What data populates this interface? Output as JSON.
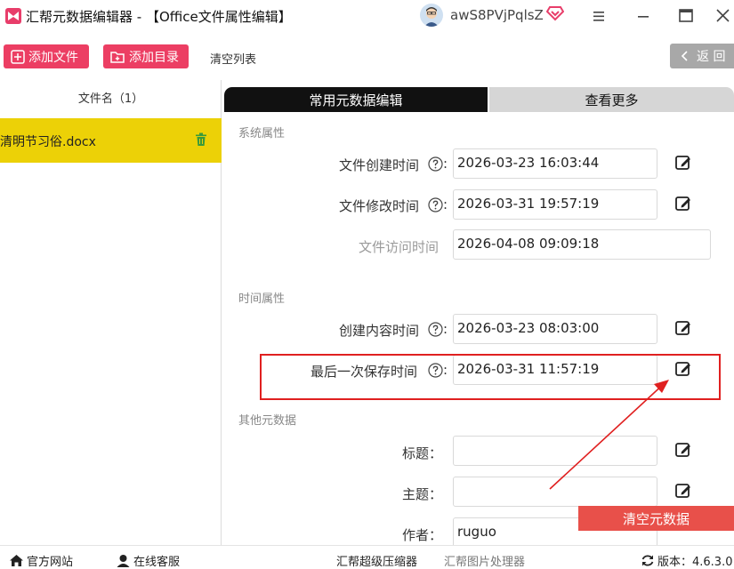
{
  "window": {
    "title": "汇帮元数据编辑器 - 【Office文件属性编辑】",
    "username": "awS8PVjPqlsZ"
  },
  "toolbar": {
    "add_file": "添加文件",
    "add_dir": "添加目录",
    "clear_list": "清空列表",
    "back": "返 回"
  },
  "file_list": {
    "header": "文件名（1）",
    "files": [
      {
        "name": "清明节习俗.docx"
      }
    ]
  },
  "tabs": {
    "common": "常用元数据编辑",
    "more": "查看更多"
  },
  "sections": {
    "system": "系统属性",
    "time": "时间属性",
    "other": "其他元数据"
  },
  "fields": {
    "created": {
      "label": "文件创建时间",
      "value": "2026-03-23 16:03:44"
    },
    "modified": {
      "label": "文件修改时间",
      "value": "2026-03-31 19:57:19"
    },
    "accessed": {
      "label": "文件访问时间",
      "value": "2026-04-08 09:09:18"
    },
    "content_created": {
      "label": "创建内容时间",
      "value": "2026-03-23 08:03:00"
    },
    "last_saved": {
      "label": "最后一次保存时间",
      "value": "2026-03-31 11:57:19"
    },
    "title": {
      "label": "标题：",
      "value": ""
    },
    "subject": {
      "label": "主题：",
      "value": ""
    },
    "author": {
      "label": "作者：",
      "value": "ruguo"
    }
  },
  "actions": {
    "clear_metadata": "清空元数据"
  },
  "statusbar": {
    "website": "官方网站",
    "support": "在线客服",
    "compressor": "汇帮超级压缩器",
    "image_tool": "汇帮图片处理器",
    "version": "版本：4.6.3.0"
  },
  "colors": {
    "accent": "#ec3e63",
    "selected_row": "#ecd107",
    "highlight": "#e02020",
    "clear_button": "#e8504a"
  }
}
